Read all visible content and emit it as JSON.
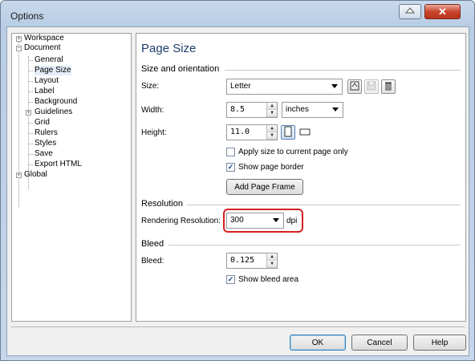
{
  "window": {
    "title": "Options"
  },
  "tree": {
    "items": [
      {
        "label": "Workspace",
        "expander": "+"
      },
      {
        "label": "Document",
        "expander": "−"
      },
      {
        "label": "General"
      },
      {
        "label": "Page Size"
      },
      {
        "label": "Layout"
      },
      {
        "label": "Label"
      },
      {
        "label": "Background"
      },
      {
        "label": "Guidelines",
        "expander": "+"
      },
      {
        "label": "Grid"
      },
      {
        "label": "Rulers"
      },
      {
        "label": "Styles"
      },
      {
        "label": "Save"
      },
      {
        "label": "Export HTML"
      },
      {
        "label": "Global",
        "expander": "+"
      }
    ],
    "selected": "Page Size"
  },
  "panel": {
    "title": "Page Size",
    "size_orientation": {
      "heading": "Size and orientation",
      "size_label": "Size:",
      "size_value": "Letter",
      "width_label": "Width:",
      "width_value": "8.5",
      "unit_value": "inches",
      "height_label": "Height:",
      "height_value": "11.0",
      "apply_current_page_label": "Apply size to current page only",
      "apply_current_page_checked": false,
      "show_page_border_label": "Show page border",
      "show_page_border_checked": true,
      "add_page_frame_label": "Add Page Frame"
    },
    "resolution": {
      "heading": "Resolution",
      "rendering_label": "Rendering Resolution:",
      "rendering_value": "300",
      "unit": "dpi"
    },
    "bleed": {
      "heading": "Bleed",
      "bleed_label": "Bleed:",
      "bleed_value": "0.125",
      "show_bleed_label": "Show bleed area",
      "show_bleed_checked": true
    }
  },
  "footer": {
    "ok_label": "OK",
    "cancel_label": "Cancel",
    "help_label": "Help"
  },
  "colors": {
    "highlight": "#d42020",
    "title_accent": "#1e3d6c"
  },
  "icons": [
    "help-icon",
    "close-icon",
    "save-preset-icon",
    "disk-icon",
    "delete-icon",
    "portrait-icon",
    "landscape-icon"
  ]
}
